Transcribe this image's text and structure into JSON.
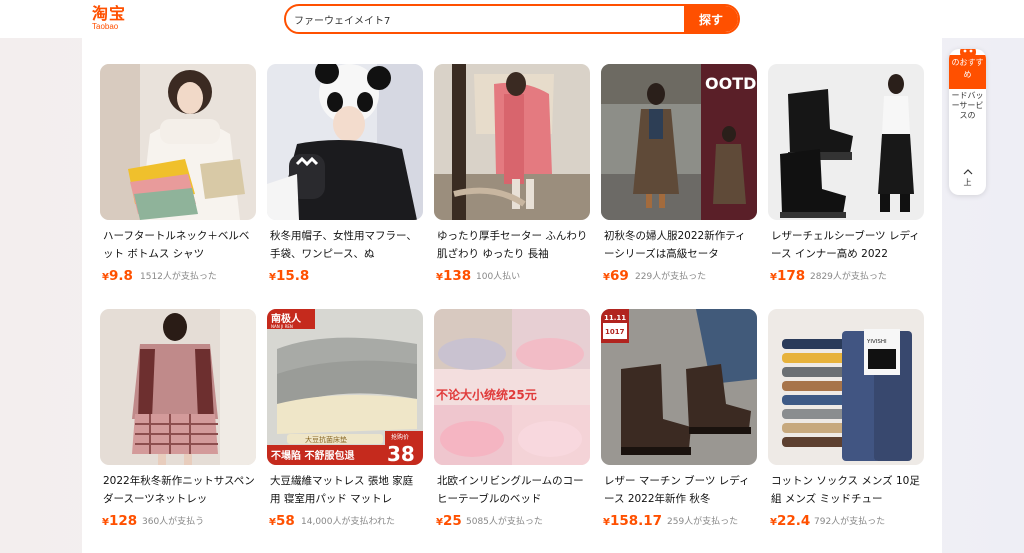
{
  "header": {
    "logo_cn": "淘宝",
    "logo_en": "Taobao",
    "search_value": "ファーウェイメイト7",
    "search_button": "探す"
  },
  "side_float": {
    "recommend_label": "のおすすめ",
    "feedback_label": "ードバッーサービスの",
    "top_label": "上"
  },
  "products": [
    {
      "title": "ハーフタートルネック＋ベルベット ボトムス シャツ",
      "currency": "¥",
      "price": "9.8",
      "sold": "1512人が支払った"
    },
    {
      "title": "秋冬用帽子、女性用マフラー、手袋、ワンピース、ぬ",
      "currency": "¥",
      "price": "15.8",
      "sold": ""
    },
    {
      "title": "ゆったり厚手セーター ふんわり肌ざわり ゆったり 長袖",
      "currency": "¥",
      "price": "138",
      "sold": "100人払い"
    },
    {
      "title": "初秋冬の婦人服2022新作ティーシリーズは高級セータ",
      "currency": "¥",
      "price": "69",
      "sold": "229人が支払った"
    },
    {
      "title": "レザーチェルシーブーツ レディース インナー高め 2022",
      "currency": "¥",
      "price": "178",
      "sold": "2829人が支払った"
    },
    {
      "title": "2022年秋冬新作ニットサスペンダースーツネットレッ",
      "currency": "¥",
      "price": "128",
      "sold": "360人が支払う"
    },
    {
      "title": "大豆繊維マットレス 張地 家庭用 寝室用パッド マットレ",
      "currency": "¥",
      "price": "58",
      "sold": "14,000人が支払われた"
    },
    {
      "title": "北欧インリビングルームのコーヒーテーブルのベッド",
      "currency": "¥",
      "price": "25",
      "sold": "5085人が支払った"
    },
    {
      "title": "レザー マーチン ブーツ レディース 2022年新作 秋冬",
      "currency": "¥",
      "price": "158.17",
      "sold": "259人が支払った"
    },
    {
      "title": "コットン ソックス メンズ 10足組 メンズ ミッドチュー",
      "currency": "¥",
      "price": "22.4",
      "sold": "792人が支払った"
    }
  ],
  "image_text": {
    "ootd": "OOTD",
    "nanjiren": "南极人",
    "nanjiren_en": "NAN JI REN",
    "mattress_tag": "大豆抗菌床垫",
    "mattress_slogan": "不塌陷 不舒服包退",
    "mattress_price_tag": "抢购价",
    "mattress_price": "38",
    "rug_slogan": "不论大小统统25元",
    "boot_sale": "11.11",
    "boot_tag": "1017",
    "socks_brand": "YIVISHI"
  },
  "colors": {
    "accent": "#ff5000",
    "text": "#111111",
    "muted": "#888888"
  }
}
